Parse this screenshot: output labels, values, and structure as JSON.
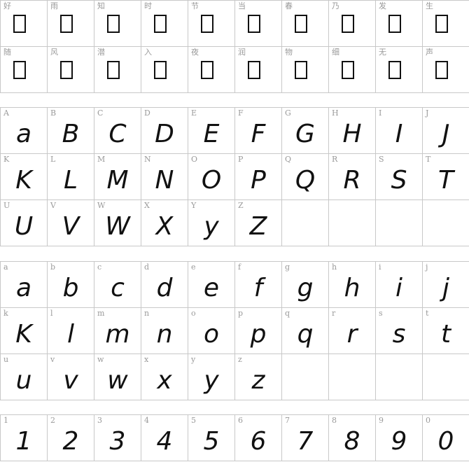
{
  "cjk": [
    "好",
    "雨",
    "知",
    "时",
    "节",
    "当",
    "春",
    "乃",
    "发",
    "生",
    "随",
    "风",
    "潜",
    "入",
    "夜",
    "润",
    "物",
    "细",
    "无",
    "声"
  ],
  "upper": [
    "A",
    "B",
    "C",
    "D",
    "E",
    "F",
    "G",
    "H",
    "I",
    "J",
    "K",
    "L",
    "M",
    "N",
    "O",
    "P",
    "Q",
    "R",
    "S",
    "T",
    "U",
    "V",
    "W",
    "X",
    "Y",
    "Z",
    "",
    "",
    "",
    ""
  ],
  "upper_glyphs": [
    "a",
    "B",
    "C",
    "D",
    "E",
    "F",
    "G",
    "H",
    "I",
    "J",
    "K",
    "L",
    "M",
    "N",
    "O",
    "P",
    "Q",
    "R",
    "S",
    "T",
    "U",
    "V",
    "W",
    "X",
    "y",
    "Z",
    "",
    "",
    "",
    ""
  ],
  "lower": [
    "a",
    "b",
    "c",
    "d",
    "e",
    "f",
    "g",
    "h",
    "i",
    "j",
    "k",
    "l",
    "m",
    "n",
    "o",
    "p",
    "q",
    "r",
    "s",
    "t",
    "u",
    "v",
    "w",
    "x",
    "y",
    "z",
    "",
    "",
    "",
    ""
  ],
  "lower_glyphs": [
    "a",
    "b",
    "c",
    "d",
    "e",
    "f",
    "g",
    "h",
    "i",
    "j",
    "K",
    "l",
    "m",
    "n",
    "o",
    "p",
    "q",
    "r",
    "s",
    "t",
    "u",
    "v",
    "w",
    "x",
    "y",
    "z",
    "",
    "",
    "",
    ""
  ],
  "digits": [
    "1",
    "2",
    "3",
    "4",
    "5",
    "6",
    "7",
    "8",
    "9",
    "0"
  ],
  "digit_glyphs": [
    "1",
    "2",
    "3",
    "4",
    "5",
    "6",
    "7",
    "8",
    "9",
    "0"
  ]
}
